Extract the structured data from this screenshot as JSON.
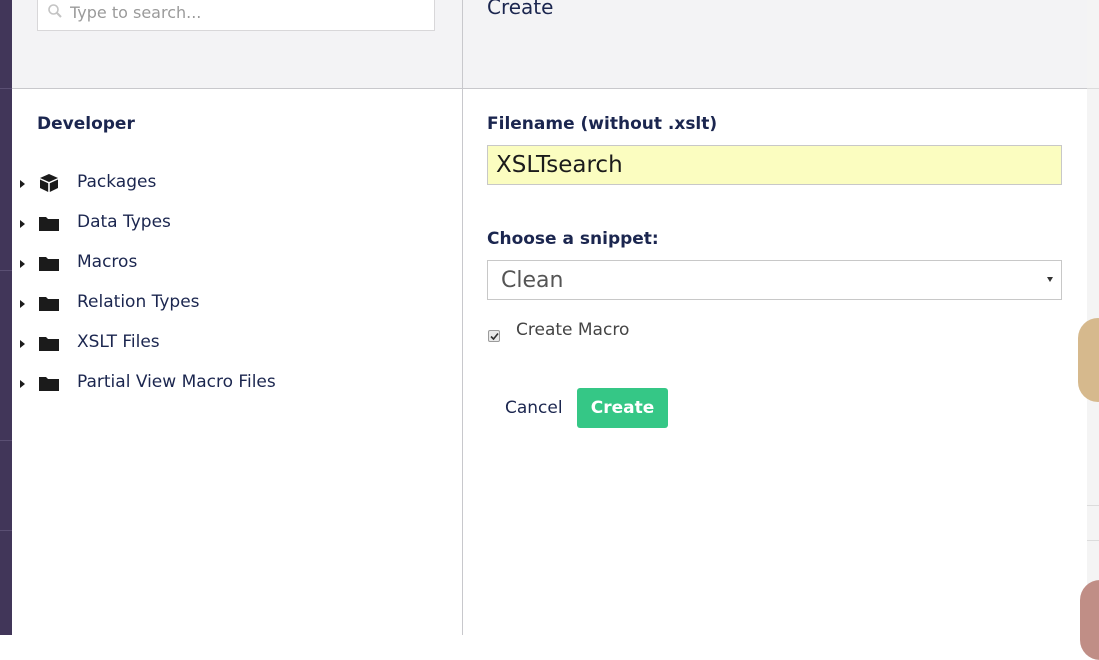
{
  "search": {
    "placeholder": "Type to search..."
  },
  "tree": {
    "section_title": "Developer",
    "items": [
      {
        "label": "Packages",
        "icon": "package-icon"
      },
      {
        "label": "Data Types",
        "icon": "folder-icon"
      },
      {
        "label": "Macros",
        "icon": "folder-icon"
      },
      {
        "label": "Relation Types",
        "icon": "folder-icon"
      },
      {
        "label": "XSLT Files",
        "icon": "folder-icon"
      },
      {
        "label": "Partial View Macro Files",
        "icon": "folder-icon"
      }
    ]
  },
  "dialog": {
    "title": "Create",
    "filename_label": "Filename (without .xslt)",
    "filename_value": "XSLTsearch",
    "snippet_label": "Choose a snippet:",
    "snippet_value": "Clean",
    "create_macro_label": "Create Macro",
    "create_macro_checked": true,
    "cancel_label": "Cancel",
    "create_label": "Create"
  },
  "colors": {
    "accent": "#35c786",
    "sidebar": "#413659",
    "highlight_input": "#fbfdc0"
  }
}
